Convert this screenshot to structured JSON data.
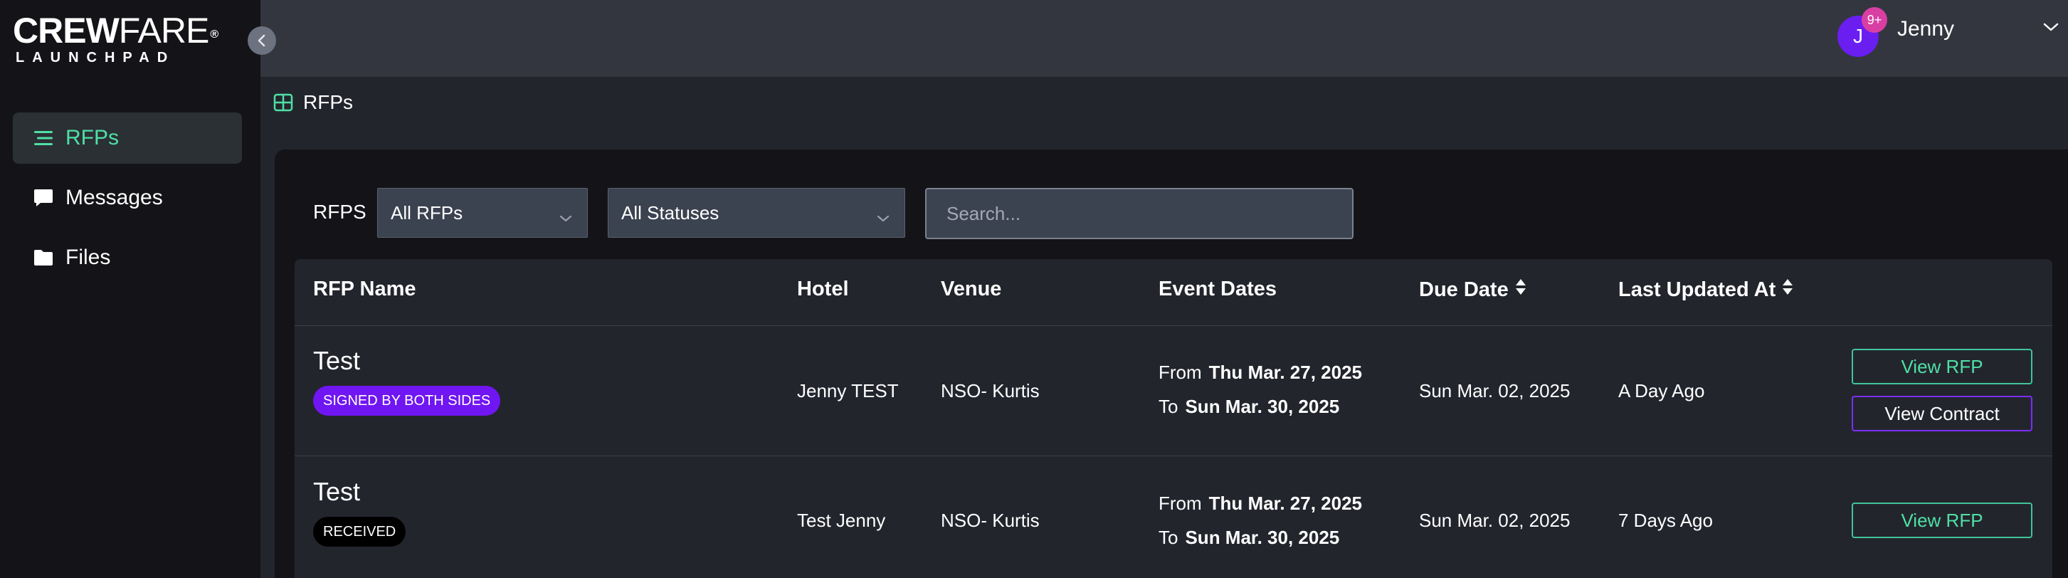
{
  "brand": {
    "logo_bold": "CREW",
    "logo_thin": "FARE",
    "logo_mark": "®",
    "logo_sub": "LAUNCHPAD"
  },
  "sidebar": {
    "items": [
      {
        "label": "RFPs",
        "icon": "list-icon",
        "active": true
      },
      {
        "label": "Messages",
        "icon": "chat-bubble-icon",
        "active": false
      },
      {
        "label": "Files",
        "icon": "folder-icon",
        "active": false
      }
    ]
  },
  "topbar": {
    "avatar_initial": "J",
    "notification_badge": "9+",
    "user_name": "Jenny"
  },
  "breadcrumb": {
    "label": "RFPs"
  },
  "filters": {
    "label": "RFPS",
    "rfp_select": "All RFPs",
    "status_select": "All Statuses",
    "search_placeholder": "Search..."
  },
  "table": {
    "headers": {
      "rfp_name": "RFP Name",
      "hotel": "Hotel",
      "venue": "Venue",
      "event_dates": "Event Dates",
      "due_date": "Due Date",
      "last_updated": "Last Updated At"
    },
    "date_prefix_from": "From",
    "date_prefix_to": "To",
    "rows": [
      {
        "name": "Test",
        "status": "SIGNED BY BOTH SIDES",
        "status_color": "#7016f2",
        "hotel": "Jenny TEST",
        "venue": "NSO- Kurtis",
        "from": "Thu Mar. 27, 2025",
        "to": "Sun Mar. 30, 2025",
        "due": "Sun Mar. 02, 2025",
        "updated": "A Day Ago",
        "actions": [
          "View RFP",
          "View Contract"
        ]
      },
      {
        "name": "Test",
        "status": "RECEIVED",
        "status_color": "#000000",
        "hotel": "Test Jenny",
        "venue": "NSO- Kurtis",
        "from": "Thu Mar. 27, 2025",
        "to": "Sun Mar. 30, 2025",
        "due": "Sun Mar. 02, 2025",
        "updated": "7 Days Ago",
        "actions": [
          "View RFP"
        ]
      }
    ]
  },
  "colors": {
    "accent_green": "#4fe0a5",
    "accent_purple": "#7b2ff7",
    "sidebar_bg": "#141418",
    "topbar_bg": "#33363f"
  }
}
